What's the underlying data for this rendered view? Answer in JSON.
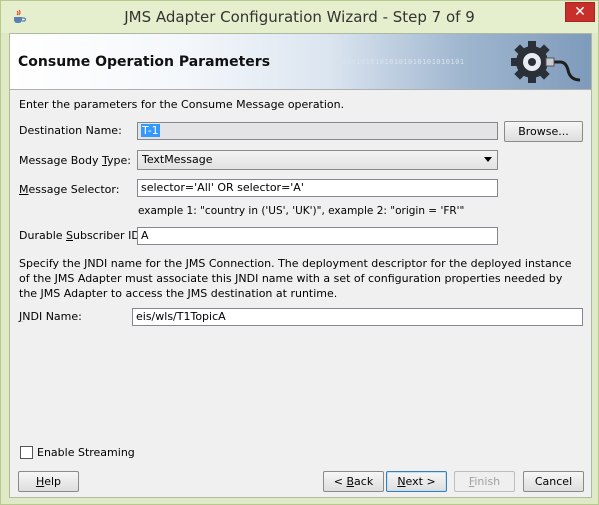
{
  "window": {
    "title": "JMS Adapter Configuration Wizard - Step 7 of 9",
    "close_glyph": "✕"
  },
  "header": {
    "title": "Consume Operation Parameters",
    "binary_text": "01010101010101010101010101"
  },
  "form": {
    "intro": "Enter the parameters for the Consume Message operation.",
    "destination_name": {
      "label_pre": "Destination Name:",
      "value": "T-1"
    },
    "browse_button": {
      "pre": "",
      "key": "",
      "post": "Browse..."
    },
    "message_body_type": {
      "label_pre": "Message Body ",
      "label_key": "T",
      "label_post": "ype:",
      "value": "TextMessage"
    },
    "message_selector": {
      "label_pre": "",
      "label_key": "M",
      "label_post": "essage Selector:",
      "value": "selector='All' OR selector='A'"
    },
    "selector_example": "example 1: \"country in ('US', 'UK')\", example 2: \"origin = 'FR'\"",
    "durable_subscriber": {
      "label_pre": "Durable ",
      "label_key": "S",
      "label_post": "ubscriber ID:",
      "value": "A"
    },
    "jndi_description": "Specify the JNDI name for the JMS Connection.  The deployment descriptor for the deployed instance of the JMS Adapter must associate this JNDI name with a set of configuration properties needed by the JMS Adapter to access the JMS destination at runtime.",
    "jndi_name": {
      "label_pre": "",
      "label_key": "J",
      "label_post": "NDI Name:",
      "value": "eis/wls/T1TopicA"
    },
    "enable_streaming": {
      "label": "Enable Streaming",
      "checked": false
    }
  },
  "footer": {
    "help": {
      "key": "H",
      "post": "elp"
    },
    "back": {
      "pre": "< ",
      "key": "B",
      "post": "ack"
    },
    "next": {
      "key": "N",
      "post": "ext >"
    },
    "finish": {
      "key": "F",
      "post": "inish",
      "enabled": false
    },
    "cancel": "Cancel"
  }
}
